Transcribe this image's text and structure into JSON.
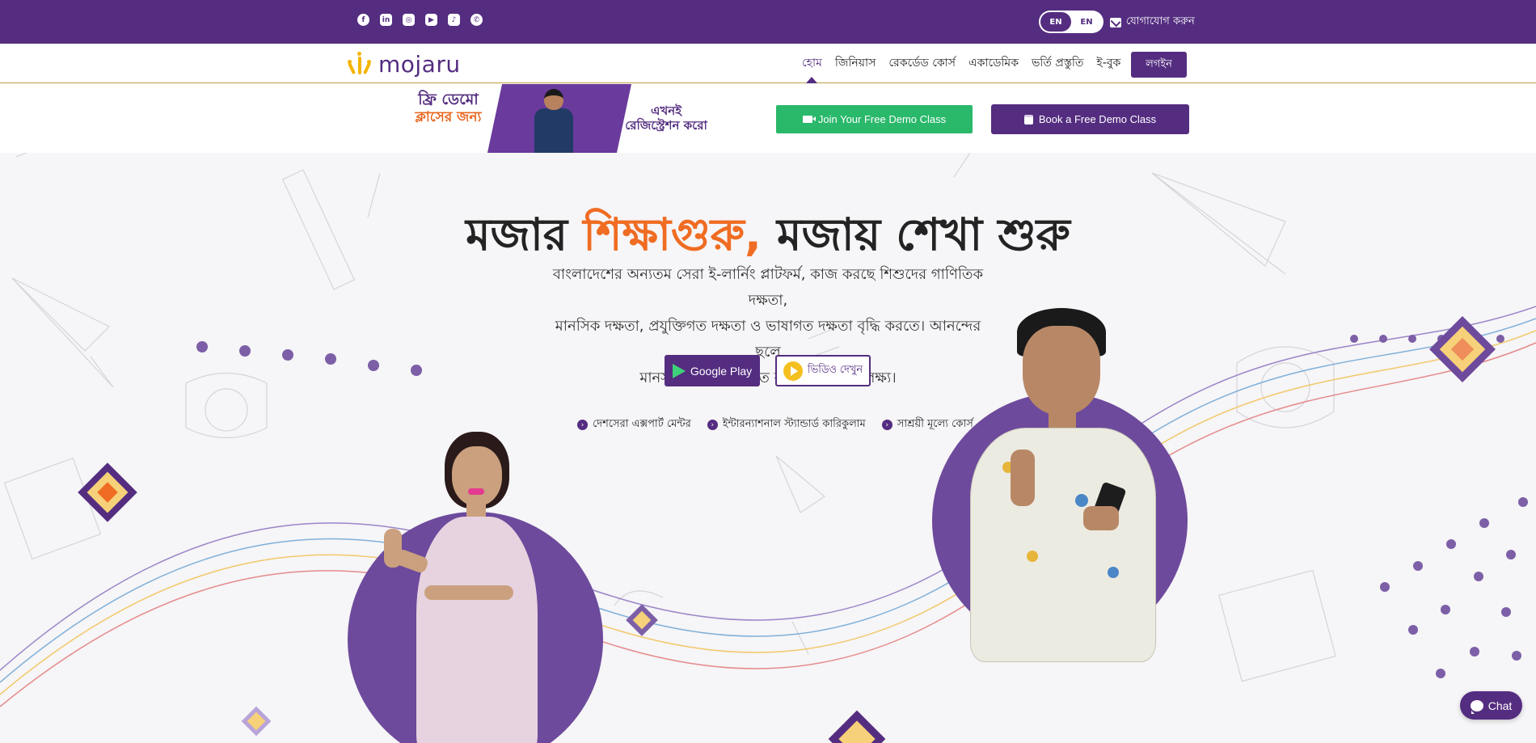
{
  "topbar": {
    "socials": [
      {
        "icon": "facebook-icon",
        "glyph": "f"
      },
      {
        "icon": "linkedin-icon",
        "glyph": "in"
      },
      {
        "icon": "instagram-icon",
        "glyph": "◎"
      },
      {
        "icon": "youtube-icon",
        "glyph": "▶"
      },
      {
        "icon": "tiktok-icon",
        "glyph": "♪"
      },
      {
        "icon": "whatsapp-icon",
        "glyph": "✆"
      }
    ],
    "lang_active": "EN",
    "lang_other": "EN",
    "contact_label": "যোগাযোগ করুন"
  },
  "nav": {
    "logo_text": "mojaru",
    "items": [
      "হোম",
      "জিনিয়াস",
      "রেকর্ডেড কোর্স",
      "একাডেমিক",
      "ভর্তি প্রস্তুতি",
      "ই-বুক"
    ],
    "active_index": 0,
    "login_label": "লগইন"
  },
  "promo": {
    "banner_line1": "ফ্রি ডেমো",
    "banner_line2": "ক্লাসের জন্য",
    "banner_line3": "এখনই",
    "banner_line4": "রেজিস্ট্রেশন করো",
    "join_label": "Join Your Free Demo Class",
    "book_label": "Book a Free Demo Class"
  },
  "hero": {
    "title_part1": "মজার ",
    "title_highlight": "শিক্ষাগুরু,",
    "title_part2": " মজায় শেখা শুরু",
    "desc_line1": "বাংলাদেশের অন্যতম সেরা ই-লার্নিং প্লাটফর্ম, কাজ করছে শিশুদের গাণিতিক দক্ষতা,",
    "desc_line2": "মানসিক দক্ষতা, প্রযুক্তিগত দক্ষতা ও ভাষাগত দক্ষতা বৃদ্ধি করতে। আনন্দের ছলে",
    "desc_line3": "মানসম্মত শিক্ষা নিশ্চিত করাই আমাদের লক্ষ্য।",
    "google_play_label": "Google Play",
    "video_label": "ভিডিও দেখুন",
    "features": [
      "দেশসেরা এক্সপার্ট মেন্টর",
      "ইন্টারন্যাশনাল স্ট্যান্ডার্ড কারিকুলাম",
      "সাশ্রয়ী মূল্যে কোর্স"
    ]
  },
  "chat_label": "Chat",
  "colors": {
    "brand_purple": "#542d80",
    "highlight_orange": "#ef6c22",
    "green": "#2ab86b",
    "yellow": "#f4b400"
  }
}
